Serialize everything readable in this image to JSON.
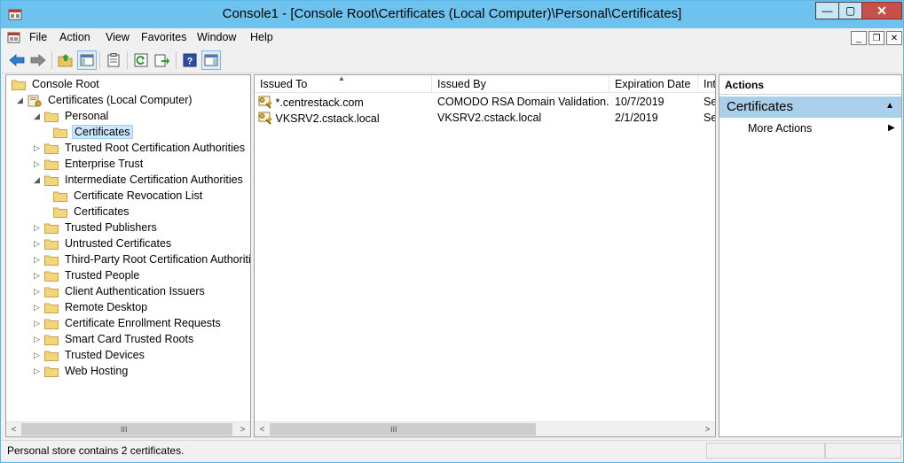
{
  "window": {
    "title": "Console1 - [Console Root\\Certificates (Local Computer)\\Personal\\Certificates]",
    "controls": {
      "minimize": "—",
      "maximize": "▢",
      "close": "✕"
    }
  },
  "menu": {
    "items": [
      "File",
      "Action",
      "View",
      "Favorites",
      "Window",
      "Help"
    ],
    "mdi_controls": {
      "minimize": "_",
      "restore": "❐",
      "close": "✕"
    }
  },
  "toolbar": {
    "buttons": [
      "back-icon",
      "forward-icon",
      "up-folder-icon",
      "show-hide-tree-icon",
      "properties-icon",
      "refresh-icon",
      "export-list-icon",
      "help-icon",
      "show-hide-action-pane-icon"
    ]
  },
  "tree": {
    "root": "Console Root",
    "snapin": "Certificates (Local Computer)",
    "items": [
      {
        "label": "Personal",
        "level": 2,
        "expander": "◢"
      },
      {
        "label": "Certificates",
        "level": 3,
        "expander": ""
      },
      {
        "label": "Trusted Root Certification Authorities",
        "level": 2,
        "expander": "▷"
      },
      {
        "label": "Enterprise Trust",
        "level": 2,
        "expander": "▷"
      },
      {
        "label": "Intermediate Certification Authorities",
        "level": 2,
        "expander": "◢"
      },
      {
        "label": "Certificate Revocation List",
        "level": 3,
        "expander": ""
      },
      {
        "label": "Certificates",
        "level": 3,
        "expander": ""
      },
      {
        "label": "Trusted Publishers",
        "level": 2,
        "expander": "▷"
      },
      {
        "label": "Untrusted Certificates",
        "level": 2,
        "expander": "▷"
      },
      {
        "label": "Third-Party Root Certification Authorities",
        "level": 2,
        "expander": "▷"
      },
      {
        "label": "Trusted People",
        "level": 2,
        "expander": "▷"
      },
      {
        "label": "Client Authentication Issuers",
        "level": 2,
        "expander": "▷"
      },
      {
        "label": "Remote Desktop",
        "level": 2,
        "expander": "▷"
      },
      {
        "label": "Certificate Enrollment Requests",
        "level": 2,
        "expander": "▷"
      },
      {
        "label": "Smart Card Trusted Roots",
        "level": 2,
        "expander": "▷"
      },
      {
        "label": "Trusted Devices",
        "level": 2,
        "expander": "▷"
      },
      {
        "label": "Web Hosting",
        "level": 2,
        "expander": "▷"
      }
    ],
    "selected_index": 1
  },
  "list": {
    "columns": [
      "Issued To",
      "Issued By",
      "Expiration Date",
      "Int"
    ],
    "sort_indicator": "▲",
    "rows": [
      [
        "*.centrestack.com",
        "COMODO RSA Domain Validation...",
        "10/7/2019",
        "Se"
      ],
      [
        "VKSRV2.cstack.local",
        "VKSRV2.cstack.local",
        "2/1/2019",
        "Se"
      ]
    ]
  },
  "actions": {
    "header": "Actions",
    "section": "Certificates",
    "section_arrow": "▲",
    "items": [
      {
        "label": "More Actions",
        "arrow": "▶"
      }
    ]
  },
  "scroll": {
    "left": "<",
    "right": ">",
    "grip": "III"
  },
  "status": {
    "text": "Personal store contains 2 certificates."
  }
}
